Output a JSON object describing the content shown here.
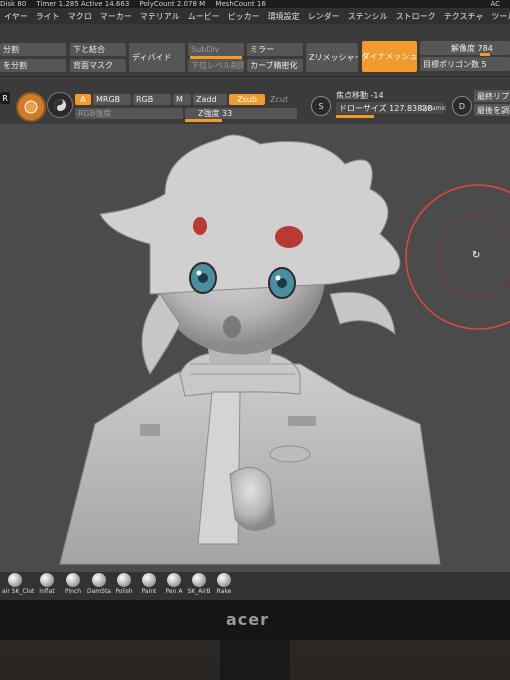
{
  "status_bar": {
    "items": [
      "Disk 80",
      "Timer 1.285 Active 14.663",
      "PolyCount 2.078 M",
      "MeshCount 16",
      "AC"
    ]
  },
  "menu": {
    "items": [
      "イヤー",
      "ライト",
      "マクロ",
      "マーカー",
      "マテリアル",
      "ムービー",
      "ピッカー",
      "環境設定",
      "レンダー",
      "ステンシル",
      "ストローク",
      "テクスチャ",
      "ツール"
    ]
  },
  "geometry": {
    "split_top": "分割",
    "split_bottom": "を分割",
    "merge_down": "下と結合",
    "backface_mask": "背面マスク",
    "divide": "ディバイド",
    "subdiv": "SubDiv",
    "delete_lower": "下位レベル削除",
    "mirror": "ミラー",
    "curve_refine": "カーブ精密化",
    "zremesher": "Zリメッシャー",
    "dynamesh": "ダイナメッシュ",
    "resolution_label": "解像度 784",
    "target_poly_label": "目標ポリゴン数 5"
  },
  "draw": {
    "a_btn": "A",
    "mrgb": "MRGB",
    "rgb": "RGB",
    "m": "M",
    "zadd": "Zadd",
    "zsub": "Zsub",
    "zcut": "Zcut",
    "rgb_intensity": "RGB強度",
    "z_intensity": "Z強度 33",
    "z_intensity_value": 33,
    "focal_shift": "焦点移動 -14",
    "draw_size": "ドローサイズ 127.83828",
    "dynamic": "Dynamic",
    "s_key": "S",
    "d_key": "D",
    "latest_1": "最終リプレ",
    "latest_2": "最後を調整"
  },
  "brushes": [
    "air SK_Clot",
    "Inflat",
    "Pinch",
    "DamSta",
    "Polish",
    "Paint",
    "Pen A",
    "SK_AirB",
    "Rake"
  ],
  "monitor_logo": "acer",
  "colors": {
    "accent": "#f29a2e",
    "ui_bg": "#3b3b3b",
    "button": "#565656",
    "viewport": "#4b4b4b",
    "cursor_ring": "#e0483c"
  }
}
